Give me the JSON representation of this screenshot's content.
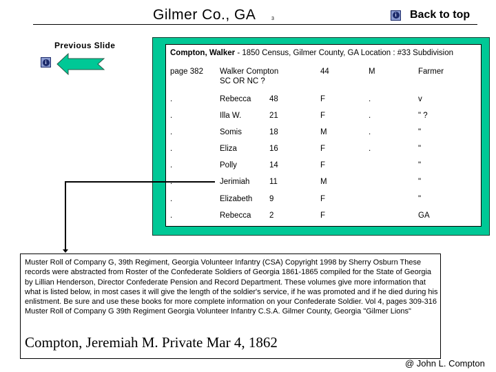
{
  "header": {
    "title": "Gilmer Co., GA",
    "slide_number": "3",
    "back_to_top_label": "Back to top",
    "back_to_top_icon": "info-icon"
  },
  "navigation": {
    "previous_label": "Previous Slide",
    "previous_icon": "info-icon",
    "previous_arrow_icon": "left-arrow-icon"
  },
  "colors": {
    "panel_green": "#00c896",
    "icon_blue": "#8c9cd0"
  },
  "census": {
    "name": "Compton, Walker",
    "description": " - 1850 Census, Gilmer County, GA Location : #33 Subdivision",
    "rows": [
      {
        "col1": "page 382",
        "name": "Walker Compton",
        "name_line2": "SC OR NC ?",
        "age": "44",
        "sex": "M",
        "col5": "",
        "col6": "Farmer"
      },
      {
        "col1": ".",
        "name": "Rebecca",
        "age": "48",
        "sex": "F",
        "col5": ".",
        "col6": "v"
      },
      {
        "col1": ".",
        "name": "Illa W.",
        "age": "21",
        "sex": "F",
        "col5": ".",
        "col6": "\" ?"
      },
      {
        "col1": ".",
        "name": "Somis",
        "age": "18",
        "sex": "M",
        "col5": ".",
        "col6": "\""
      },
      {
        "col1": ".",
        "name": "Eliza",
        "age": "16",
        "sex": "F",
        "col5": ".",
        "col6": "\""
      },
      {
        "col1": ".",
        "name": "Polly",
        "age": "14",
        "sex": "F",
        "col5": "",
        "col6": "\""
      },
      {
        "col1": ".",
        "name": "Jerimiah",
        "age": "11",
        "sex": "M",
        "col5": "",
        "col6": "\""
      },
      {
        "col1": ".",
        "name": "Elizabeth",
        "age": "9",
        "sex": "F",
        "col5": "",
        "col6": "\""
      },
      {
        "col1": ".",
        "name": "Rebecca",
        "age": "2",
        "sex": "F",
        "col5": "",
        "col6": "GA"
      }
    ]
  },
  "muster": {
    "text": "Muster Roll of Company G, 39th Regiment, Georgia Volunteer Infantry (CSA) Copyright 1998 by Sherry Osburn These records were abstracted from Roster of the Confederate Soldiers of Georgia 1861-1865 compiled for the State of Georgia by Lillian Henderson, Director Confederate Pension and Record Department. These volumes give more information that what is listed below, in most cases it will give the length of the soldier's service, if he was promoted and if he died during his enlistment. Be sure and use these books for more complete information on your Confederate Soldier. Vol 4, pages 309-316 Muster Roll of Company G 39th Regiment Georgia Volunteer Infantry C.S.A. Gilmer County, Georgia \"Gilmer Lions\"",
    "highlight": "Compton, Jeremiah M. Private Mar 4, 1862"
  },
  "footer": {
    "copyright": "@ John L. Compton"
  }
}
